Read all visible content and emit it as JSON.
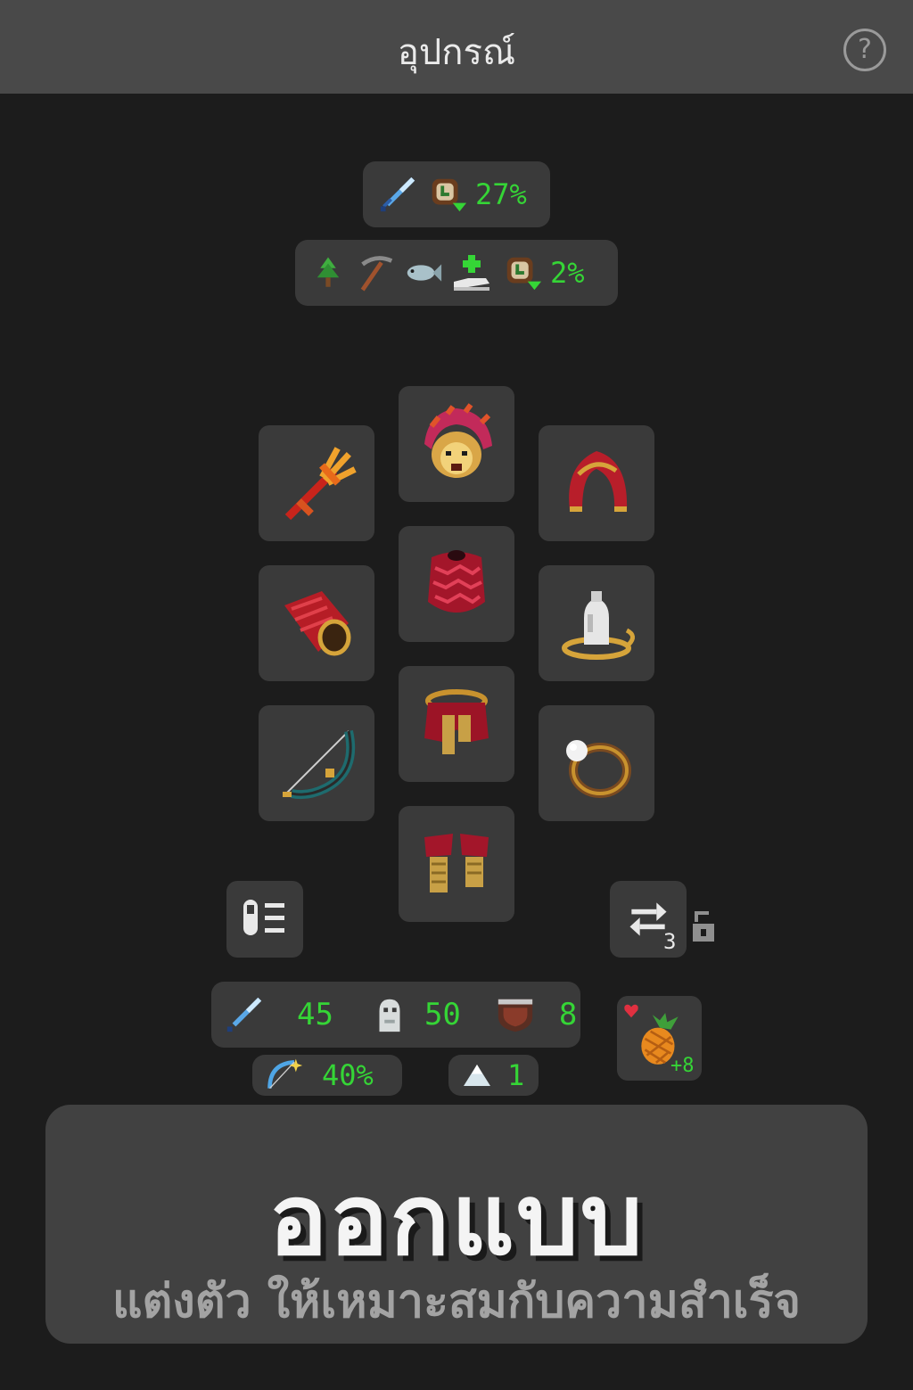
{
  "header": {
    "title": "อุปกรณ์",
    "help_label": "?"
  },
  "bonuses": {
    "combat_bonus": "27%",
    "gathering_bonus": "2%"
  },
  "equipment": {
    "slots": [
      {
        "slot": "weapon",
        "icon": "trident-icon"
      },
      {
        "slot": "head",
        "icon": "lion-headdress-icon"
      },
      {
        "slot": "cape",
        "icon": "red-hood-cape-icon"
      },
      {
        "slot": "gloves",
        "icon": "red-gauntlet-icon"
      },
      {
        "slot": "body",
        "icon": "feather-armor-icon"
      },
      {
        "slot": "amulet",
        "icon": "white-bust-amulet-icon"
      },
      {
        "slot": "offhand",
        "icon": "bow-icon"
      },
      {
        "slot": "legs",
        "icon": "feather-skirt-icon"
      },
      {
        "slot": "ring",
        "icon": "pearl-ring-icon"
      },
      {
        "slot": "boots",
        "icon": "feather-boots-icon"
      }
    ],
    "swap_count": "3"
  },
  "stats": {
    "attack": "45",
    "health": "50",
    "defense": "8",
    "crit": "40%",
    "level": "1"
  },
  "food": {
    "icon": "pineapple-icon",
    "bonus": "+8"
  },
  "banner": {
    "headline": "ออกแบบ",
    "subline": "แต่งตัว ให้เหมาะสมกับความสำเร็จ"
  },
  "colors": {
    "accent_green": "#35d536",
    "panel": "#3a3a3a",
    "background": "#1c1c1c"
  }
}
